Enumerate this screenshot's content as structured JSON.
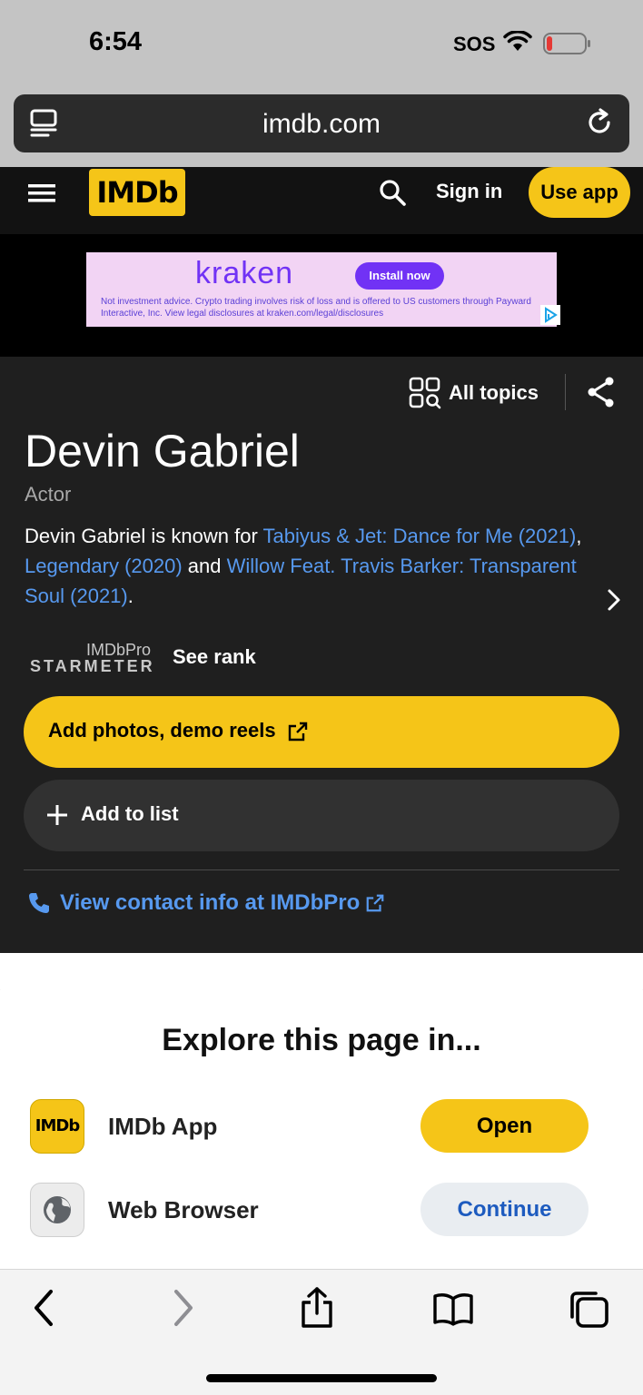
{
  "status_bar": {
    "time": "6:54",
    "carrier": "SOS"
  },
  "browser": {
    "url": "imdb.com"
  },
  "header": {
    "logo": "IMDb",
    "sign_in": "Sign in",
    "use_app": "Use app"
  },
  "ad": {
    "brand": "kraken",
    "cta": "Install now",
    "disclaimer": "Not investment advice. Crypto trading involves risk of loss and is offered to US customers through Payward Interactive, Inc. View legal disclosures at kraken.com/legal/disclosures",
    "brand_color": "#7132f5"
  },
  "topics": {
    "all_topics_label": "All topics"
  },
  "person": {
    "name": "Devin Gabriel",
    "role": "Actor",
    "bio_prefix": "Devin Gabriel is known for ",
    "bio_link1": "Tabiyus & Jet: Dance for Me (2021)",
    "bio_sep1": ", ",
    "bio_link2": "Legendary (2020)",
    "bio_sep2": " and ",
    "bio_link3": "Willow Feat. Travis Barker: Transparent Soul (2021)",
    "bio_suffix": "."
  },
  "starmeter": {
    "top": "IMDbPro",
    "bottom": "STARMETER",
    "see_rank": "See rank"
  },
  "actions": {
    "add_photos": "Add photos, demo reels",
    "add_to_list": "Add to list",
    "contact": "View contact info at IMDbPro"
  },
  "sheet": {
    "title": "Explore this page in...",
    "app_logo": "IMDb",
    "app_label": "IMDb App",
    "open": "Open",
    "browser_label": "Web Browser",
    "continue": "Continue"
  },
  "colors": {
    "imdb_yellow": "#f5c518",
    "link_blue": "#5799ef",
    "dark_bg": "#1f1f1f"
  },
  "icons": [
    "reader-icon",
    "reload-icon",
    "menu-icon",
    "search-icon",
    "grid-search-icon",
    "share-icon",
    "chevron-right-icon",
    "external-link-icon",
    "plus-icon",
    "phone-icon",
    "globe-icon",
    "back-icon",
    "forward-icon",
    "share-up-icon",
    "bookmarks-icon",
    "tabs-icon"
  ]
}
